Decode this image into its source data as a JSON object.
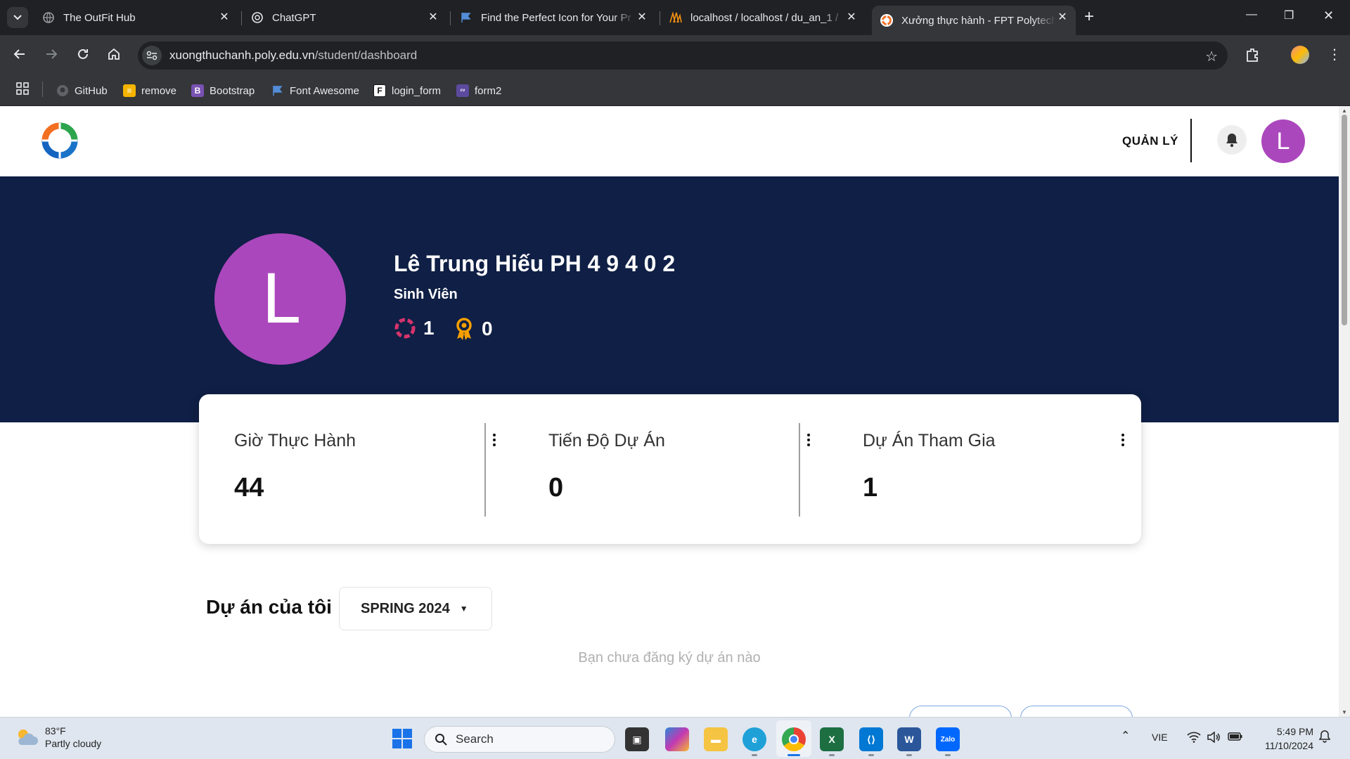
{
  "browser": {
    "tabs": [
      {
        "title": "The OutFit Hub",
        "favicon": "globe-icon"
      },
      {
        "title": "ChatGPT",
        "favicon": "chatgpt-icon"
      },
      {
        "title": "Find the Perfect Icon for Your Pr",
        "favicon": "flag-icon"
      },
      {
        "title": "localhost / localhost / du_an_1 /",
        "favicon": "phpmyadmin-icon"
      },
      {
        "title": "Xưởng thực hành - FPT Polytech",
        "favicon": "polytech-icon",
        "active": true
      }
    ],
    "url_host": "xuongthuchanh.poly.edu.vn",
    "url_path": "/student/dashboard",
    "bookmarks": [
      {
        "label": "GitHub",
        "icon": "github-icon"
      },
      {
        "label": "remove",
        "icon": "layers-icon"
      },
      {
        "label": "Bootstrap",
        "icon": "bootstrap-icon"
      },
      {
        "label": "Font Awesome",
        "icon": "flag-icon"
      },
      {
        "label": "login_form",
        "icon": "f-icon"
      },
      {
        "label": "form2",
        "icon": "canva-icon"
      }
    ]
  },
  "site": {
    "nav_manage": "QUẢN LÝ",
    "avatar_initial": "L",
    "accent_color": "#ab47bc",
    "hero_color": "#0f1f45"
  },
  "profile": {
    "name": "Lê Trung Hiếu PH 4 9 4 0 2",
    "role": "Sinh Viên",
    "avatar_initial": "L",
    "projects_count": "1",
    "awards_count": "0"
  },
  "stats": [
    {
      "label": "Giờ Thực Hành",
      "value": "44"
    },
    {
      "label": "Tiến Độ Dự Án",
      "value": "0"
    },
    {
      "label": "Dự Án Tham Gia",
      "value": "1"
    }
  ],
  "projects": {
    "title": "Dự án của tôi",
    "semester": "SPRING 2024",
    "empty_message": "Bạn chưa đăng ký dự án nào"
  },
  "taskbar": {
    "weather_temp": "83°F",
    "weather_desc": "Partly cloudy",
    "search_label": "Search",
    "language": "VIE",
    "time": "5:49 PM",
    "date": "11/10/2024"
  }
}
